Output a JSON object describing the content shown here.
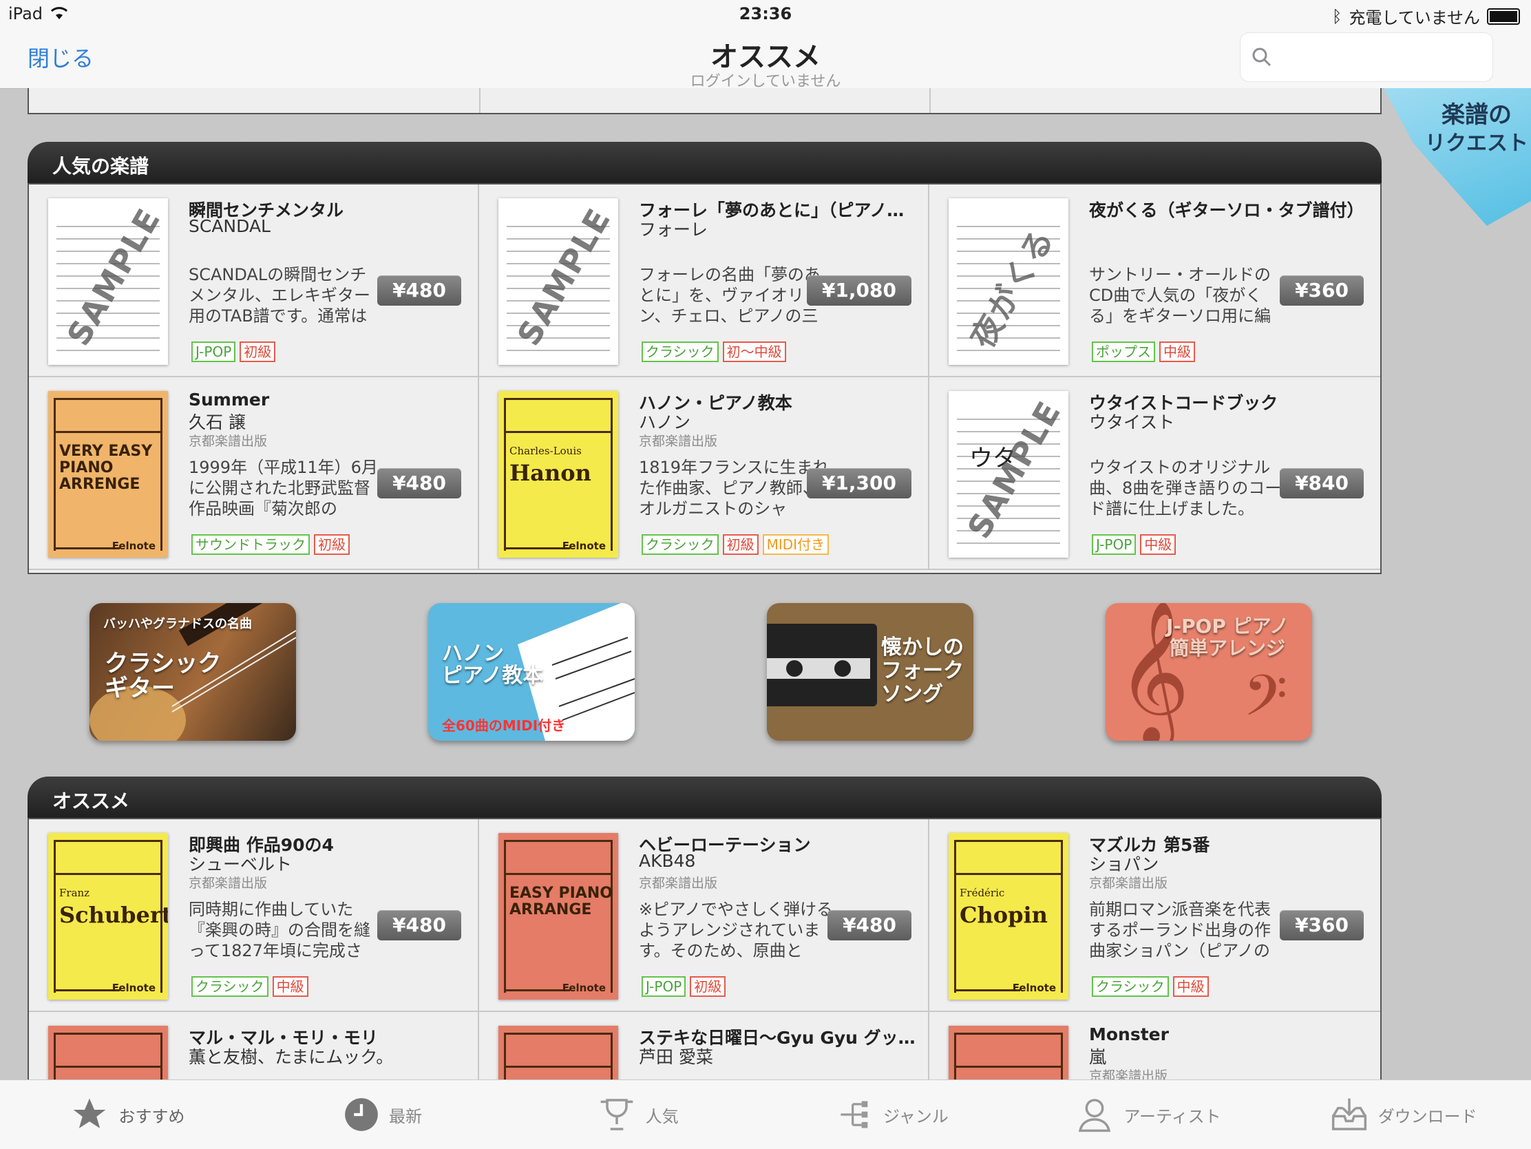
{
  "status": {
    "device": "iPad",
    "time": "23:36",
    "battery_text": "充電していません"
  },
  "nav": {
    "close": "閉じる",
    "title": "オススメ",
    "subtitle": "ログインしていません",
    "search_placeholder": ""
  },
  "request_badge": {
    "line1": "楽譜の",
    "line2": "リクエスト"
  },
  "sections": {
    "popular": {
      "title": "人気の楽譜",
      "items": [
        {
          "title": "瞬間センチメンタル",
          "artist": "SCANDAL",
          "publisher": "",
          "desc": "SCANDALの瞬間センチメンタル、エレキギター用のTAB譜です。通常は",
          "price": "¥480",
          "tags": [
            "J-POP",
            "初級"
          ],
          "thumb_sample": "SAMPLE"
        },
        {
          "title": "フォーレ「夢のあとに」（ピアノ三...",
          "artist": "フォーレ",
          "publisher": "",
          "desc": "フォーレの名曲「夢のあとに」を、ヴァイオリン、チェロ、ピアノの三",
          "price": "¥1,080",
          "tags": [
            "クラシック",
            "初〜中級"
          ],
          "thumb_sample": "SAMPLE"
        },
        {
          "title": "夜がくる（ギターソロ・タブ譜付）",
          "artist": "",
          "publisher": "",
          "desc": "サントリー・オールドのCD曲で人気の「夜がくる」をギターソロ用に編",
          "price": "¥360",
          "tags": [
            "ポップス",
            "中級"
          ],
          "thumb_sample": "夜がくる"
        },
        {
          "title": "Summer",
          "artist": "久石 譲",
          "publisher": "京都楽譜出版",
          "desc": "1999年（平成11年）6月に公開された北野武監督作品映画『菊次郎の",
          "price": "¥480",
          "tags": [
            "サウンドトラック",
            "初級"
          ],
          "book_title": "VERY EASY PIANO ARRENGE",
          "brand": "Felnote"
        },
        {
          "title": "ハノン・ピアノ教本",
          "artist": "ハノン",
          "publisher": "京都楽譜出版",
          "desc": "1819年フランスに生まれた作曲家、ピアノ教師、オルガニストのシャ",
          "price": "¥1,300",
          "tags": [
            "クラシック",
            "初級",
            "MIDI付き"
          ],
          "book_pre": "Charles-Louis",
          "book_name": "Hanon",
          "brand": "Felnote"
        },
        {
          "title": "ウタイストコードブック",
          "artist": "ウタイスト",
          "publisher": "",
          "desc": "ウタイストのオリジナル曲、8曲を弾き語りのコード譜に仕上げました。",
          "price": "¥840",
          "tags": [
            "J-POP",
            "中級"
          ],
          "thumb_sample": "SAMPLE",
          "thumb_text": "ウタ"
        }
      ]
    },
    "banners": [
      {
        "top": "バッハやグラナドスの名曲",
        "main": "クラシック\nギター"
      },
      {
        "main": "ハノン\nピアノ教本",
        "sub": "全60曲のMIDI付き"
      },
      {
        "main": "懐かしの\nフォーク\nソング"
      },
      {
        "main": "J-POP ピアノ\n簡単アレンジ"
      }
    ],
    "recommend": {
      "title": "オススメ",
      "items": [
        {
          "title": "即興曲 作品90の4",
          "artist": "シューベルト",
          "publisher": "京都楽譜出版",
          "desc": "同時期に作曲していた『楽興の時』の合間を縫って1827年頃に完成さ",
          "price": "¥480",
          "tags": [
            "クラシック",
            "中級"
          ],
          "book_pre": "Franz",
          "book_name": "Schubert",
          "brand": "Felnote"
        },
        {
          "title": "ヘビーローテーション",
          "artist": "AKB48",
          "publisher": "京都楽譜出版",
          "desc": "※ピアノでやさしく弾けるようアレンジされています。そのため、原曲と",
          "price": "¥480",
          "tags": [
            "J-POP",
            "初級"
          ],
          "book_title": "EASY PIANO ARRANGE",
          "brand": "Felnote"
        },
        {
          "title": "マズルカ 第5番",
          "artist": "ショパン",
          "publisher": "京都楽譜出版",
          "desc": "前期ロマン派音楽を代表するポーランド出身の作曲家ショパン（ピアノの",
          "price": "¥360",
          "tags": [
            "クラシック",
            "中級"
          ],
          "book_pre": "Frédéric",
          "book_name": "Chopin",
          "brand": "Felnote"
        },
        {
          "title": "マル・マル・モリ・モリ",
          "artist": "薫と友樹、たまにムック。",
          "publisher": "",
          "desc": "",
          "price": "",
          "tags": []
        },
        {
          "title": "ステキな日曜日〜Gyu Gyu グッデイ!〜",
          "artist": "芦田 愛菜",
          "publisher": "",
          "desc": "",
          "price": "",
          "tags": []
        },
        {
          "title": "Monster",
          "artist": "嵐",
          "publisher": "京都楽譜出版",
          "desc": "",
          "price": "",
          "tags": []
        }
      ]
    }
  },
  "tabs": [
    {
      "label": "おすすめ",
      "icon": "star-icon"
    },
    {
      "label": "最新",
      "icon": "clock-icon"
    },
    {
      "label": "人気",
      "icon": "trophy-icon"
    },
    {
      "label": "ジャンル",
      "icon": "tree-icon"
    },
    {
      "label": "アーティスト",
      "icon": "person-icon"
    },
    {
      "label": "ダウンロード",
      "icon": "download-icon"
    }
  ]
}
